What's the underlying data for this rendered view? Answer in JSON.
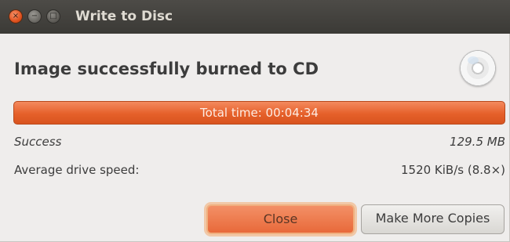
{
  "window": {
    "title": "Write to Disc",
    "controls": {
      "close_glyph": "×",
      "minimize_glyph": "−",
      "maximize_glyph": "□"
    }
  },
  "dialog": {
    "heading": "Image successfully burned to CD",
    "disc_icon": "cd-disc-icon",
    "progress": {
      "label": "Total time: 00:04:34",
      "fraction": 1.0
    },
    "status": {
      "label": "Success",
      "value": "129.5 MB"
    },
    "speed": {
      "label": "Average drive speed:",
      "value": "1520 KiB/s (8.8×)"
    },
    "buttons": {
      "close": "Close",
      "copies": "Make More Copies"
    }
  },
  "colors": {
    "accent": "#e8693a",
    "titlebar": "#3f3d39"
  }
}
